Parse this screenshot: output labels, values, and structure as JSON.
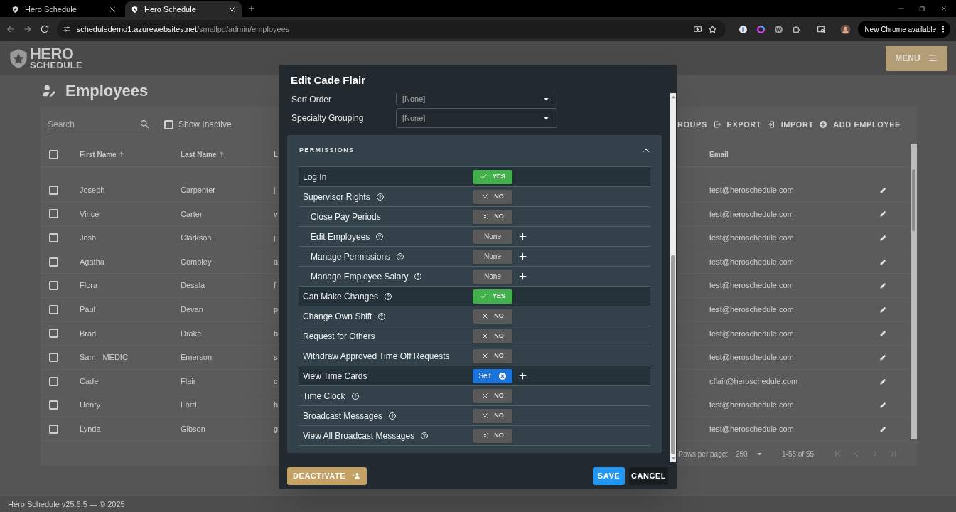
{
  "browser": {
    "tabs": [
      {
        "title": "Hero Schedule",
        "selected": false
      },
      {
        "title": "Hero Schedule",
        "selected": true
      }
    ],
    "url_host": "scheduledemo1.azurewebsites.net",
    "url_path": "/smallpd/admin/employees",
    "update_button": "New Chrome available"
  },
  "header": {
    "logo_line_1": "HERO",
    "logo_line_2": "SCHEDULE",
    "menu_button": "MENU"
  },
  "page_title": "Employees",
  "toolbar": {
    "search_placeholder": "Search",
    "show_inactive": {
      "label": "Show Inactive",
      "checked": false
    },
    "actions": [
      {
        "kind": "groups",
        "label": "ROUPS"
      },
      {
        "kind": "export",
        "label": "EXPORT"
      },
      {
        "kind": "import",
        "label": "IMPORT"
      },
      {
        "kind": "add",
        "label": "ADD EMPLOYEE"
      }
    ]
  },
  "table": {
    "columns": [
      {
        "label": "First Name",
        "sorted": true
      },
      {
        "label": "Last Name",
        "sorted": true
      },
      {
        "label": "L",
        "sorted": false
      },
      {
        "label": "Email",
        "sorted": false
      }
    ],
    "all_checked": false,
    "rows": [
      {
        "first": "Joseph",
        "last": "Carpenter",
        "col3": "j",
        "email": "test@heroschedule.com",
        "checked": false
      },
      {
        "first": "Vince",
        "last": "Carter",
        "col3": "v",
        "email": "test@heroschedule.com",
        "checked": false
      },
      {
        "first": "Josh",
        "last": "Clarkson",
        "col3": "j",
        "email": "test@heroschedule.com",
        "checked": false
      },
      {
        "first": "Agatha",
        "last": "Compley",
        "col3": "a",
        "email": "test@heroschedule.com",
        "checked": false
      },
      {
        "first": "Flora",
        "last": "Desala",
        "col3": "f",
        "email": "test@heroschedule.com",
        "checked": false
      },
      {
        "first": "Paul",
        "last": "Devan",
        "col3": "p",
        "email": "test@heroschedule.com",
        "checked": false
      },
      {
        "first": "Brad",
        "last": "Drake",
        "col3": "b",
        "email": "test@heroschedule.com",
        "checked": false
      },
      {
        "first": "Sam - MEDIC",
        "last": "Emerson",
        "col3": "s",
        "email": "test@heroschedule.com",
        "checked": false
      },
      {
        "first": "Cade",
        "last": "Flair",
        "col3": "c",
        "email": "cflair@heroschedule.com",
        "checked": false
      },
      {
        "first": "Henry",
        "last": "Ford",
        "col3": "h",
        "email": "test@heroschedule.com",
        "checked": false
      },
      {
        "first": "Lynda",
        "last": "Gibson",
        "col3": "g",
        "email": "test@heroschedule.com",
        "checked": false
      }
    ]
  },
  "pagination": {
    "rows_per_page_label": "Rows per page:",
    "rows_per_page": "250",
    "range": "1-55 of 55"
  },
  "footer": "Hero Schedule v25.6.5 — © 2025",
  "dialog": {
    "title": "Edit Cade Flair",
    "fields": [
      {
        "label": "Sort Order",
        "value": "[None]"
      },
      {
        "label": "Specialty Grouping",
        "value": "[None]"
      }
    ],
    "permissions": {
      "title": "PERMISSIONS",
      "expanded": true,
      "items": [
        {
          "label": "Log In",
          "help": false,
          "kind": "toggle",
          "on": true,
          "value": "YES"
        },
        {
          "label": "Supervisor Rights",
          "help": true,
          "kind": "toggle",
          "on": false,
          "value": "NO",
          "children": [
            {
              "label": "Close Pay Periods",
              "help": false,
              "kind": "toggle",
              "on": false,
              "value": "NO"
            },
            {
              "label": "Edit Employees",
              "help": true,
              "kind": "scope",
              "on": false,
              "value": "None"
            },
            {
              "label": "Manage Permissions",
              "help": true,
              "kind": "scope",
              "on": false,
              "value": "None"
            },
            {
              "label": "Manage Employee Salary",
              "help": true,
              "kind": "scope",
              "on": false,
              "value": "None"
            }
          ]
        },
        {
          "label": "Can Make Changes",
          "help": true,
          "kind": "toggle",
          "on": true,
          "value": "YES"
        },
        {
          "label": "Change Own Shift",
          "help": true,
          "kind": "toggle",
          "on": false,
          "value": "NO"
        },
        {
          "label": "Request for Others",
          "help": false,
          "kind": "toggle",
          "on": false,
          "value": "NO"
        },
        {
          "label": "Withdraw Approved Time Off Requests",
          "help": false,
          "kind": "toggle",
          "on": false,
          "value": "NO"
        },
        {
          "label": "View Time Cards",
          "help": false,
          "kind": "scope",
          "on": true,
          "value": "Self"
        },
        {
          "label": "Time Clock",
          "help": true,
          "kind": "toggle",
          "on": false,
          "value": "NO"
        },
        {
          "label": "Broadcast Messages",
          "help": true,
          "kind": "toggle",
          "on": false,
          "value": "NO"
        },
        {
          "label": "View All Broadcast Messages",
          "help": true,
          "kind": "toggle",
          "on": false,
          "value": "NO"
        }
      ]
    },
    "buttons": {
      "deactivate": "DEACTIVATE",
      "save": "SAVE",
      "cancel": "CANCEL"
    }
  }
}
